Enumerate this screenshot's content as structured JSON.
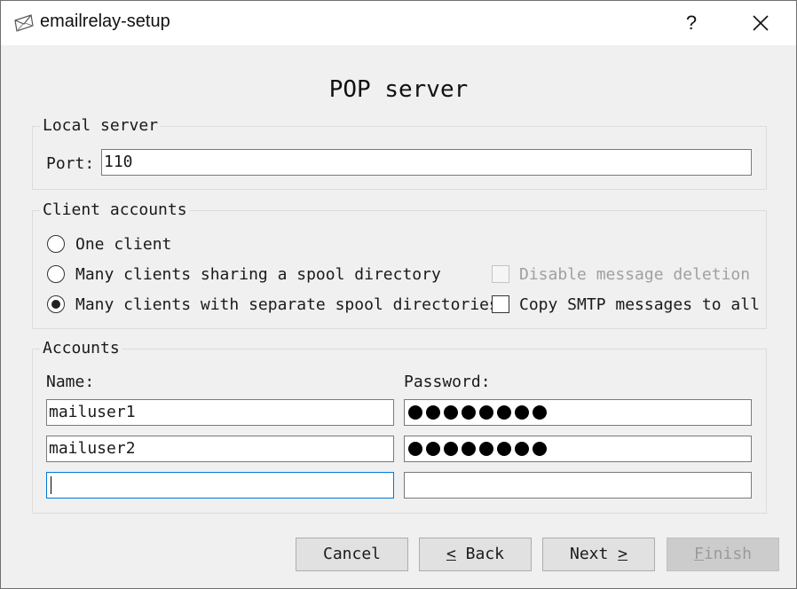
{
  "window": {
    "title": "emailrelay-setup",
    "help_glyph": "?",
    "icons": {
      "app": "envelope-icon",
      "help": "question-mark-icon",
      "close": "close-icon"
    }
  },
  "page": {
    "heading": "POP server"
  },
  "local_server": {
    "group_title": "Local server",
    "port_label": "Port:",
    "port_value": "110"
  },
  "client_accounts": {
    "group_title": "Client accounts",
    "options": [
      {
        "label": "One client",
        "checked": false
      },
      {
        "label": "Many clients sharing a spool directory",
        "checked": false
      },
      {
        "label": "Many clients with separate spool directories",
        "checked": true
      }
    ],
    "disable_deletion": {
      "label": "Disable message deletion",
      "checked": false,
      "enabled": false
    },
    "copy_smtp": {
      "label": "Copy SMTP messages to all",
      "checked": false,
      "enabled": true
    }
  },
  "accounts": {
    "group_title": "Accounts",
    "name_header": "Name:",
    "password_header": "Password:",
    "rows": [
      {
        "name": "mailuser1",
        "password_dots": 8
      },
      {
        "name": "mailuser2",
        "password_dots": 8
      },
      {
        "name": "",
        "password_dots": 0
      }
    ]
  },
  "buttons": {
    "cancel": "Cancel",
    "back": {
      "mnemonic": "<",
      "text": " Back"
    },
    "next": {
      "text": "Next ",
      "mnemonic": ">"
    },
    "finish": {
      "mnemonic": "F",
      "text": "inish",
      "enabled": false
    }
  }
}
